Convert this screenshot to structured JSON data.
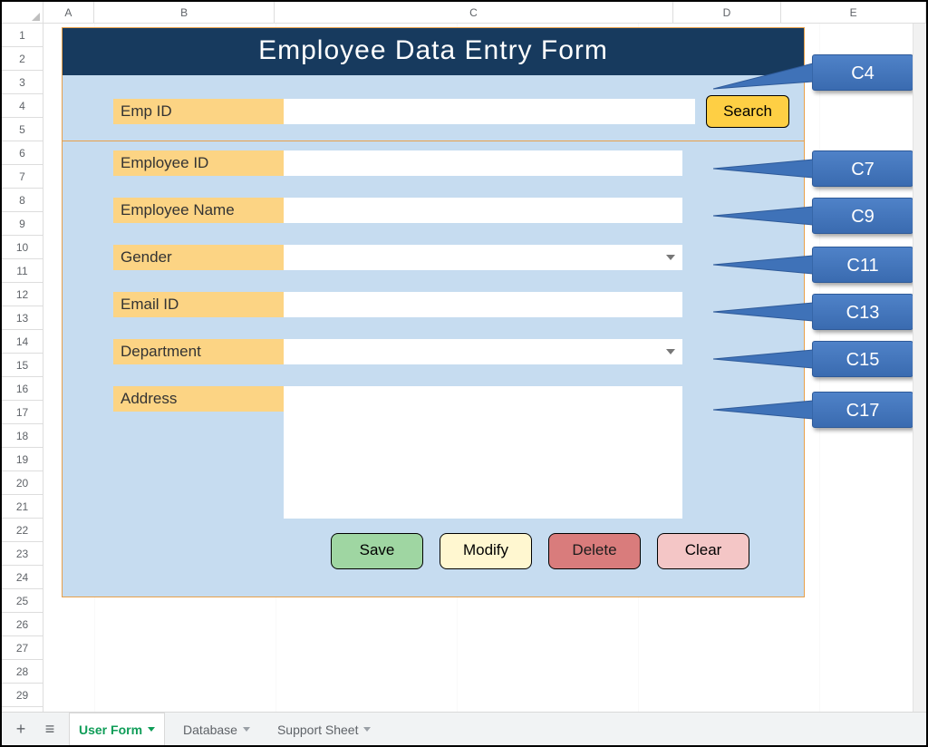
{
  "columns": [
    "A",
    "B",
    "C",
    "D",
    "E"
  ],
  "rows": [
    "1",
    "2",
    "3",
    "4",
    "5",
    "6",
    "7",
    "8",
    "9",
    "10",
    "11",
    "12",
    "13",
    "14",
    "15",
    "16",
    "17",
    "18",
    "19",
    "20",
    "21",
    "22",
    "23",
    "24",
    "25",
    "26",
    "27",
    "28",
    "29"
  ],
  "form": {
    "title": "Employee Data Entry Form",
    "search_label": "Emp ID",
    "search_button": "Search",
    "labels": {
      "emp_id": "Employee ID",
      "emp_name": "Employee Name",
      "gender": "Gender",
      "email": "Email ID",
      "department": "Department",
      "address": "Address"
    },
    "buttons": {
      "save": "Save",
      "modify": "Modify",
      "delete": "Delete",
      "clear": "Clear"
    }
  },
  "callouts": [
    "C4",
    "C7",
    "C9",
    "C11",
    "C13",
    "C15",
    "C17"
  ],
  "tabs": {
    "add": "+",
    "all": "≡",
    "items": [
      "User Form",
      "Database",
      "Support Sheet"
    ],
    "active": 0
  }
}
